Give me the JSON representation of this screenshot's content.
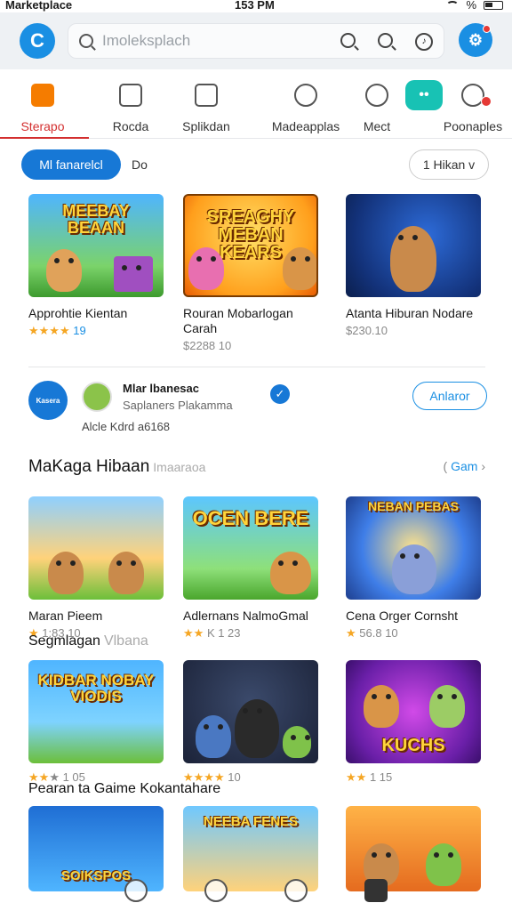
{
  "status_bar": {
    "carrier": "Marketplace",
    "time": "153 PM",
    "battery": "%"
  },
  "header": {
    "search_placeholder": "Imoleksplach",
    "logo_letter": "C"
  },
  "categories": [
    {
      "label": "Sterapo"
    },
    {
      "label": "Rocda"
    },
    {
      "label": "Splikdan"
    },
    {
      "label": "Madeapplas"
    },
    {
      "label": "Mect"
    },
    {
      "label": "Poonaples"
    }
  ],
  "filters": {
    "primary": "Ml fanarelcl",
    "secondary": "Do",
    "dropdown": "1 Hikan v"
  },
  "featured": [
    {
      "thumb_text": "MEEBAY BEAAN",
      "title": "Approhtie Kientan",
      "rating_stars": "★★★★",
      "rating_num": "19"
    },
    {
      "thumb_text": "SREAGHY MEBAN KEARS",
      "title": "Rouran Mobarlogan Carah",
      "price": "$2288 10"
    },
    {
      "thumb_text": "",
      "title": "Atanta Hiburan Nodare",
      "price": "$230.10"
    }
  ],
  "promo": {
    "name": "Mlar lbanesac",
    "subtitle": "Saplaners Plakamma",
    "meta": "Alcle Kdrd a6168",
    "button": "Anlaror",
    "logo_text": "Kasera"
  },
  "section_1": {
    "title": "MaKaga Hibaan",
    "subtitle": "Imaaraoa",
    "see_all": "Gam",
    "games": [
      {
        "title": "Maran Pieem",
        "rating": "★",
        "rating_text": "1:83 10"
      },
      {
        "thumb_text": "OCEN BERE",
        "title": "Adlernans NalmoGmal",
        "rating": "★★",
        "rating_text": "K 1 23"
      },
      {
        "thumb_text": "NEBAN PEBAS",
        "title": "Cena Orger Cornsht",
        "rating": "★",
        "rating_text": "56.8 10"
      }
    ]
  },
  "section_2": {
    "title": "Segmlagan",
    "subtitle": "Vlbana",
    "games": [
      {
        "thumb_text": "KIDBAR NOBAY VIODIS",
        "rating": "★★",
        "rating_gray": "★",
        "rating_text": "1 05"
      },
      {
        "rating": "★★★★",
        "rating_text": "10"
      },
      {
        "thumb_text": "KUCHS",
        "rating": "★★",
        "rating_text": "1 15"
      }
    ]
  },
  "section_3": {
    "title": "Pearan ta Gaime Kokantahare",
    "games": [
      {
        "thumb_text": "SOIKSPOS"
      },
      {
        "thumb_text": "NEEBA FENES"
      },
      {
        "thumb_text": ""
      }
    ]
  },
  "colors": {
    "accent": "#1778d6",
    "teal": "#18c2b4",
    "active_tab": "#d32f2f",
    "star": "#f5a623"
  },
  "bottom_nav": [
    "home-icon",
    "discover-icon",
    "clock-icon",
    "library-icon"
  ]
}
